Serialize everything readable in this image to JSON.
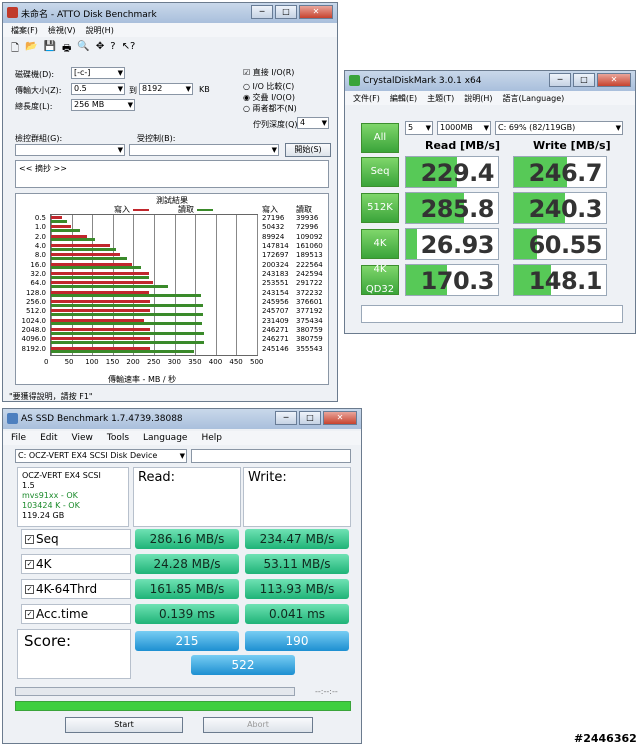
{
  "atto": {
    "title": "未命名 - ATTO Disk Benchmark",
    "menu": [
      "檔案(F)",
      "檢視(V)",
      "說明(H)"
    ],
    "drive_label": "磁碟機(D):",
    "drive_value": "[-c-]",
    "transfer_label": "傳輸大小(Z):",
    "transfer_from": "0.5",
    "to_label": "到",
    "transfer_to": "8192",
    "kb_label": "KB",
    "length_label": "總長度(L):",
    "length_value": "256 MB",
    "direct_io": "直接 I/O(R)",
    "io_compare": "I/O 比較(C)",
    "overlapped_io": "交叠 I/O(O)",
    "neither": "兩者都不(N)",
    "queue_label": "佇列深度(Q):",
    "queue_value": "4",
    "control_label": "檢控群組(G):",
    "restricted_label": "受控制(B):",
    "start_button": "開始(S)",
    "notes": "<< 摘抄 >>",
    "results_title": "測試結果",
    "write_legend": "寫入",
    "read_legend": "讀取",
    "col_write": "寫入",
    "col_read": "讀取",
    "axis_caption": "傳輸速率 - MB / 秒",
    "status": "\"要獲得說明，請按 F1\""
  },
  "chart_data": {
    "type": "bar",
    "categories": [
      "0.5",
      "1.0",
      "2.0",
      "4.0",
      "8.0",
      "16.0",
      "32.0",
      "64.0",
      "128.0",
      "256.0",
      "512.0",
      "1024.0",
      "2048.0",
      "4096.0",
      "8192.0"
    ],
    "series": [
      {
        "name": "寫入",
        "values": [
          27196,
          50432,
          89924,
          147814,
          172697,
          200324,
          243183,
          253551,
          243154,
          245956,
          245707,
          231409,
          246271,
          246271,
          245146
        ]
      },
      {
        "name": "讀取",
        "values": [
          39936,
          72996,
          109092,
          161060,
          189513,
          222564,
          242594,
          291722,
          372232,
          376601,
          377192,
          375434,
          380759,
          380759,
          355543
        ]
      }
    ],
    "xticks": [
      "0",
      "50",
      "100",
      "150",
      "200",
      "250",
      "300",
      "350",
      "400",
      "450",
      "500"
    ],
    "xlim": [
      0,
      500
    ],
    "grid": true
  },
  "crystal": {
    "title": "CrystalDiskMark 3.0.1 x64",
    "menu": [
      "文件(F)",
      "編輯(E)",
      "主題(T)",
      "說明(H)",
      "語言(Language)"
    ],
    "all_button": "All",
    "count": "5",
    "size": "1000MB",
    "drive": "C: 69% (82/119GB)",
    "read_header": "Read [MB/s]",
    "write_header": "Write [MB/s]",
    "rows": [
      {
        "label": "Seq",
        "read": "229.4",
        "write": "246.7"
      },
      {
        "label": "512K",
        "read": "285.8",
        "write": "240.3"
      },
      {
        "label": "4K",
        "read": "26.93",
        "write": "60.55"
      },
      {
        "label": "4K\nQD32",
        "read": "170.3",
        "write": "148.1"
      }
    ],
    "fills": {
      "read": [
        0.55,
        0.63,
        0.12,
        0.45
      ],
      "write": [
        0.58,
        0.55,
        0.25,
        0.4
      ]
    }
  },
  "asssd": {
    "title": "AS SSD Benchmark 1.7.4739.38088",
    "menu": [
      "File",
      "Edit",
      "View",
      "Tools",
      "Language",
      "Help"
    ],
    "device": "C: OCZ-VERT EX4 SCSI Disk Device",
    "info": [
      "OCZ-VERT EX4 SCSI",
      "1.5",
      "mvs91xx - OK",
      "103424 K - OK",
      "119.24 GB"
    ],
    "read_header": "Read:",
    "write_header": "Write:",
    "rows": [
      {
        "label": "Seq",
        "read": "286.16 MB/s",
        "write": "234.47 MB/s"
      },
      {
        "label": "4K",
        "read": "24.28 MB/s",
        "write": "53.11 MB/s"
      },
      {
        "label": "4K-64Thrd",
        "read": "161.85 MB/s",
        "write": "113.93 MB/s"
      },
      {
        "label": "Acc.time",
        "read": "0.139 ms",
        "write": "0.041 ms"
      }
    ],
    "score_label": "Score:",
    "score_read": "215",
    "score_write": "190",
    "score_total": "522",
    "time": "--:--:--",
    "start_button": "Start",
    "abort_button": "Abort"
  },
  "watermark": "#2446362"
}
